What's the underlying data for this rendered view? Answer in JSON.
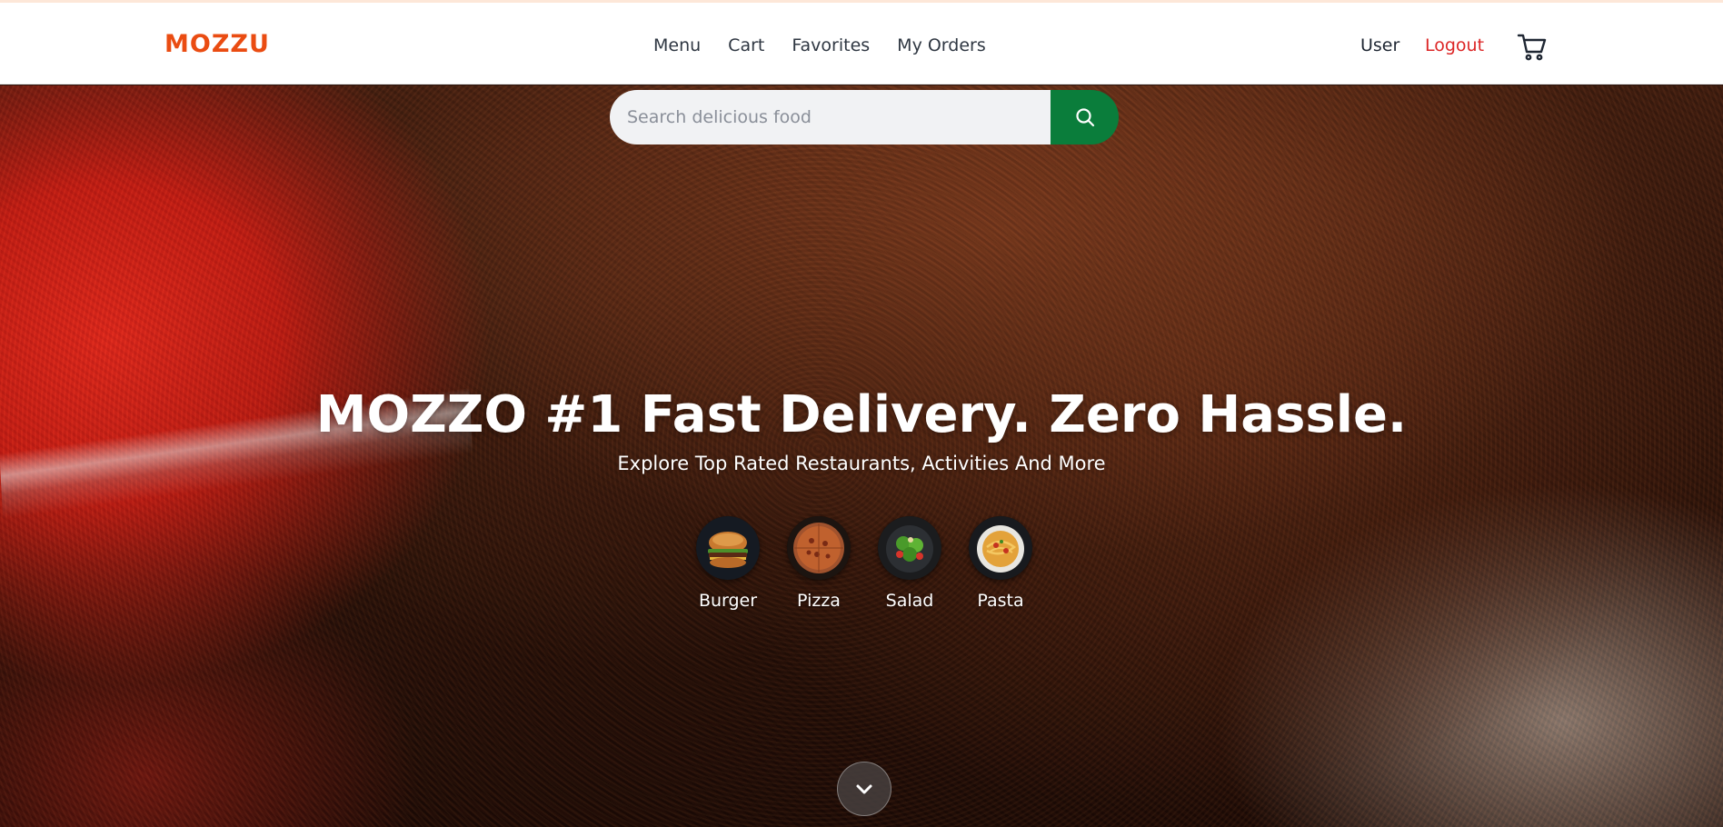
{
  "header": {
    "logo": "MOZZU",
    "nav": [
      {
        "label": "Menu"
      },
      {
        "label": "Cart"
      },
      {
        "label": "Favorites"
      },
      {
        "label": "My Orders"
      }
    ],
    "user_label": "User",
    "logout_label": "Logout",
    "cart_icon": "shopping-cart-icon"
  },
  "search": {
    "placeholder": "Search delicious food",
    "value": "",
    "button_icon": "search-icon"
  },
  "hero": {
    "title": "MOZZO #1 Fast Delivery. Zero Hassle.",
    "subtitle": "Explore Top Rated Restaurants, Activities And More",
    "categories": [
      {
        "label": "Burger"
      },
      {
        "label": "Pizza"
      },
      {
        "label": "Salad"
      },
      {
        "label": "Pasta"
      }
    ],
    "scroll_icon": "chevron-down-icon"
  },
  "colors": {
    "brand": "#ea4c12",
    "logout": "#dc2626",
    "search_button": "#0a7d3b"
  }
}
